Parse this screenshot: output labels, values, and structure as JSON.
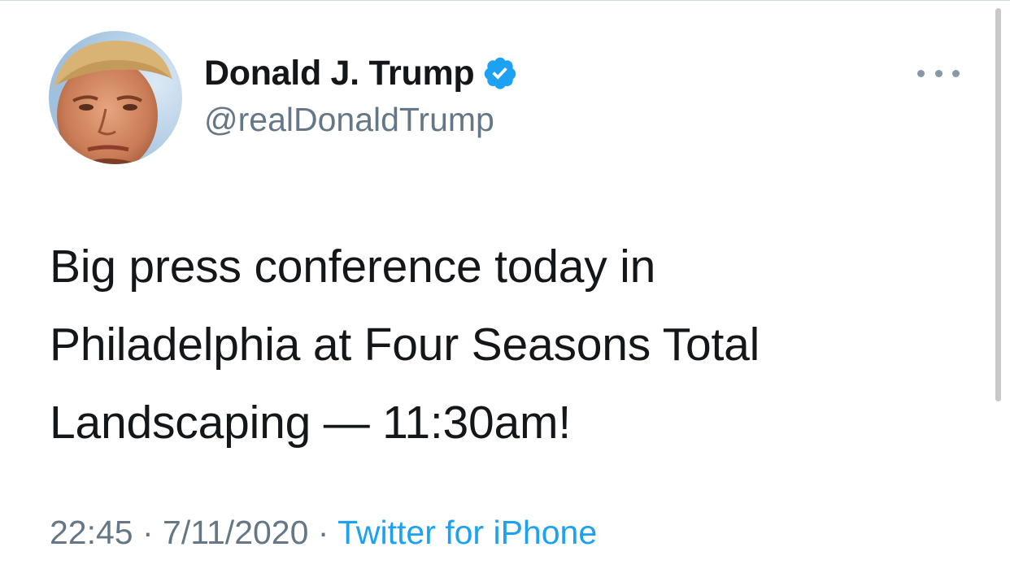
{
  "author": {
    "display_name": "Donald J. Trump",
    "handle": "@realDonaldTrump",
    "verified": true,
    "avatar_icon": "profile-photo"
  },
  "tweet": {
    "lines": [
      "Big press conference today in",
      "Philadelphia at Four Seasons Total",
      "Landscaping — 11:30am!"
    ]
  },
  "meta": {
    "time": "22:45",
    "separator": " · ",
    "date": "7/11/2020",
    "source": "Twitter for iPhone"
  },
  "icons": {
    "more": "more-horizontal-icon",
    "verified": "verified-badge-icon"
  },
  "colors": {
    "text": "#14171a",
    "secondary": "#657786",
    "accent": "#1da1f2"
  }
}
